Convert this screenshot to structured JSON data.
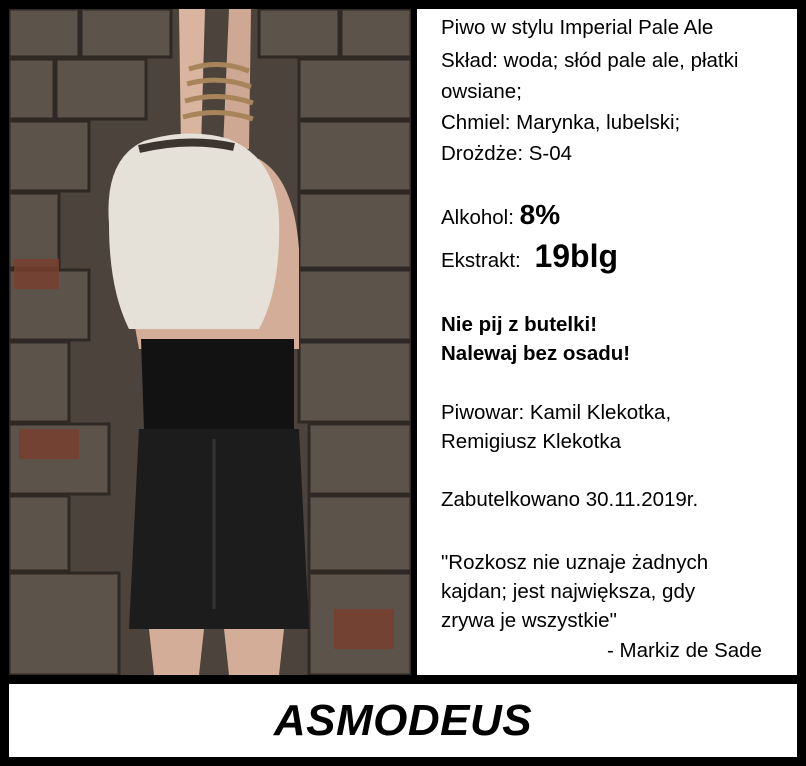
{
  "label": {
    "style_line": "Piwo w stylu Imperial Pale Ale",
    "composition_line1": "Skład: woda; słód pale ale, płatki",
    "composition_line2": "owsiane;",
    "hops": "Chmiel: Marynka, lubelski;",
    "yeast": "Drożdże: S-04",
    "alcohol_label": "Alkohol:",
    "alcohol_value": "8%",
    "extract_label": "Ekstrakt:",
    "extract_value": "19blg",
    "warning_line1": "Nie pij z butelki!",
    "warning_line2": "Nalewaj bez osadu!",
    "brewer_line1": "Piwowar: Kamil Klekotka,",
    "brewer_line2": "Remigiusz Klekotka",
    "bottled": "Zabutelkowano 30.11.2019r.",
    "quote_line1": "\"Rozkosz nie uznaje żadnych",
    "quote_line2": "kajdan; jest największa, gdy",
    "quote_line3": "zrywa je wszystkie\"",
    "quote_author": "- Markiz de Sade"
  },
  "beer_name": "ASMODEUS"
}
